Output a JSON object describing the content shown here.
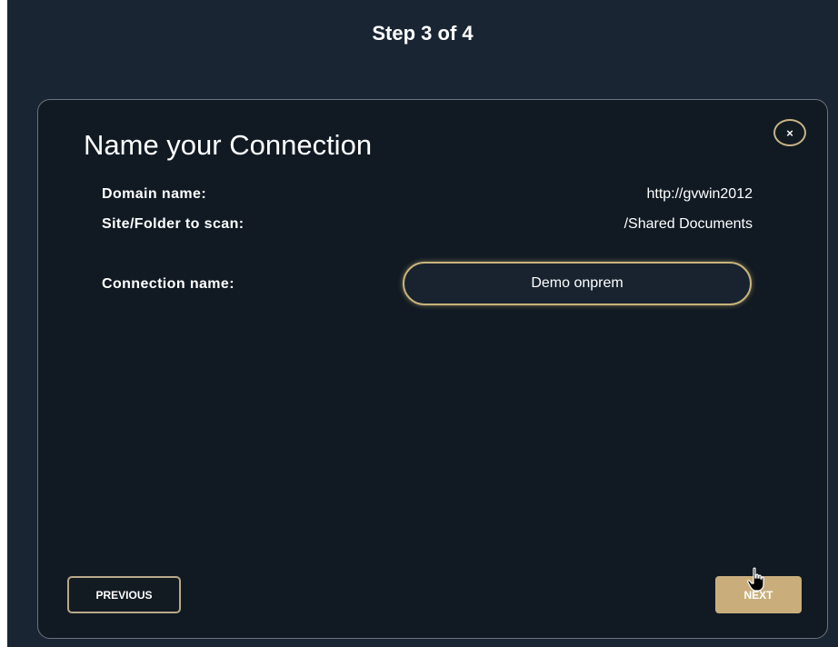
{
  "header": {
    "step_title": "Step 3 of 4"
  },
  "dialog": {
    "title": "Name your Connection",
    "close_label": "×",
    "fields": {
      "domain_label": "Domain name:",
      "domain_value": "http://gvwin2012",
      "site_label": "Site/Folder to scan:",
      "site_value": "/Shared Documents",
      "connection_label": "Connection name:",
      "connection_value": "Demo onprem"
    },
    "footer": {
      "previous_label": "PREVIOUS",
      "next_label": "NEXT"
    }
  },
  "colors": {
    "background": "#1a2533",
    "dialog_bg": "#111a23",
    "accent_gold": "#c9ae7c"
  },
  "icons": {
    "close": "close-icon",
    "cursor": "hand-pointer-icon"
  }
}
